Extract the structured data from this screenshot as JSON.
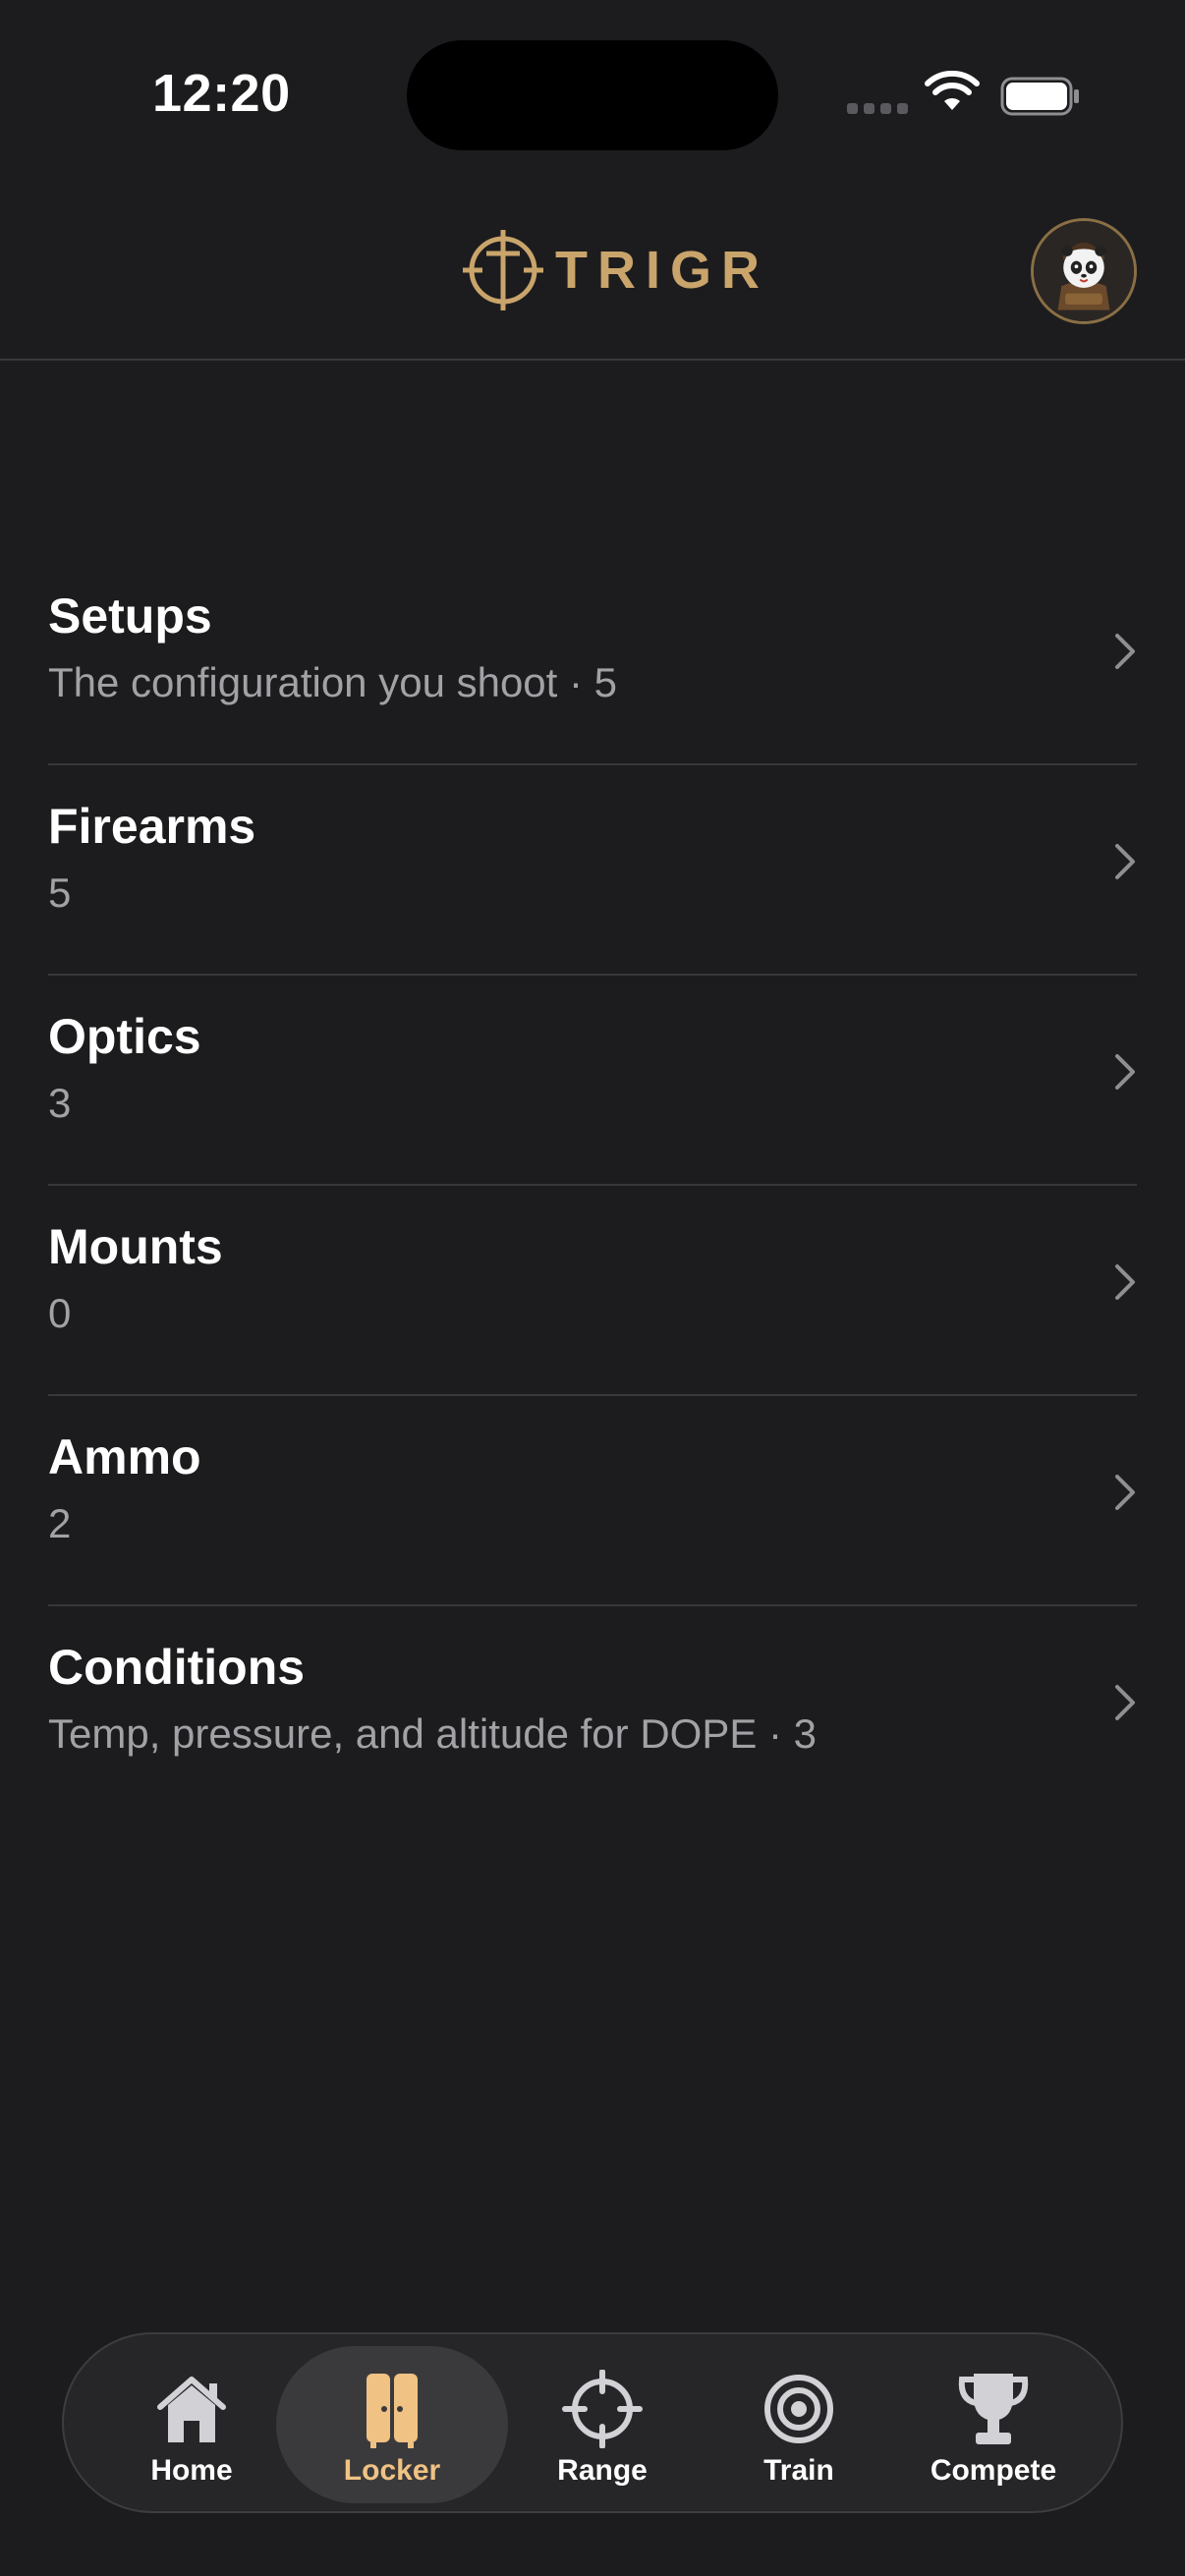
{
  "status_bar": {
    "time": "12:20"
  },
  "header": {
    "logo_text": "TRIGR"
  },
  "locker": {
    "items": [
      {
        "title": "Setups",
        "subtitle": "The configuration you shoot · 5"
      },
      {
        "title": "Firearms",
        "subtitle": "5"
      },
      {
        "title": "Optics",
        "subtitle": "3"
      },
      {
        "title": "Mounts",
        "subtitle": "0"
      },
      {
        "title": "Ammo",
        "subtitle": "2"
      },
      {
        "title": "Conditions",
        "subtitle": "Temp, pressure, and altitude for DOPE · 3"
      }
    ]
  },
  "tabs": [
    {
      "label": "Home",
      "icon": "home-icon"
    },
    {
      "label": "Locker",
      "icon": "locker-icon",
      "active": true
    },
    {
      "label": "Range",
      "icon": "crosshair-icon"
    },
    {
      "label": "Train",
      "icon": "target-icon"
    },
    {
      "label": "Compete",
      "icon": "trophy-icon"
    }
  ],
  "colors": {
    "background": "#1c1c1e",
    "accent": "#c9a46b",
    "active_tab": "#f0c283",
    "subtitle": "#a1a1a6"
  }
}
